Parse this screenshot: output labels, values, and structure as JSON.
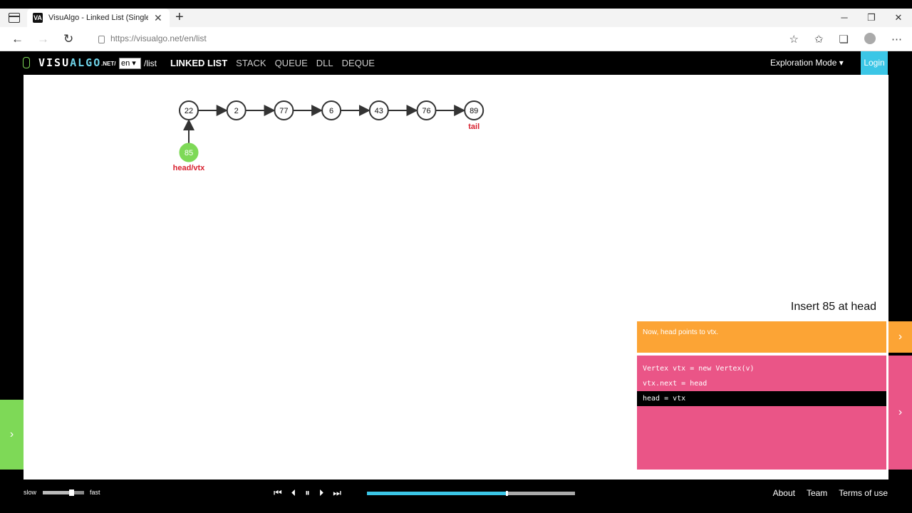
{
  "browser": {
    "tab_title": "VisuAlgo - Linked List (Single, D",
    "favicon_text": "VA",
    "url": "https://visualgo.net/en/list",
    "win_minimize": "─",
    "win_maximize": "❐",
    "win_close": "✕"
  },
  "header": {
    "logo_prefix": "VISU",
    "logo_highlight": "ALGO",
    "logo_suffix": ".NET",
    "logo_slash": "/",
    "lang": "en",
    "path": "/list",
    "nav": [
      "LINKED LIST",
      "STACK",
      "QUEUE",
      "DLL",
      "DEQUE"
    ],
    "mode": "Exploration Mode ▾",
    "login": "Login"
  },
  "linked_list": {
    "nodes": [
      "22",
      "2",
      "77",
      "6",
      "43",
      "76",
      "89"
    ],
    "tail_label": "tail",
    "new_node": "85",
    "new_node_label": "head/vtx",
    "colors": {
      "node_stroke": "#333333",
      "new_node_fill": "#7ed957",
      "label": "#d8212f"
    }
  },
  "status": {
    "title": "Insert 85 at head",
    "message": "Now, head points to vtx."
  },
  "code": {
    "lines": [
      "Vertex vtx = new Vertex(v)",
      "vtx.next = head",
      "head = vtx"
    ],
    "active_line": 2
  },
  "footer": {
    "slow": "slow",
    "fast": "fast",
    "speed_level": 0.7,
    "progress": 0.67,
    "links": [
      "About",
      "Team",
      "Terms of use"
    ]
  },
  "colors": {
    "accent_cyan": "#3bc6e6",
    "status_orange": "#fca435",
    "code_pink": "#ea5587",
    "green": "#7ed957"
  }
}
